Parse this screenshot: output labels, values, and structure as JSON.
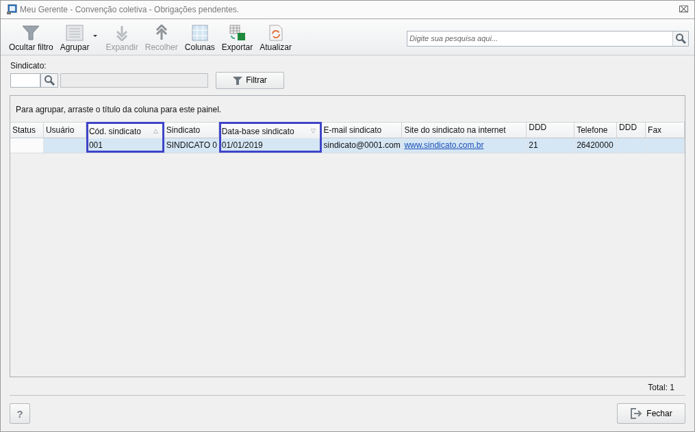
{
  "window": {
    "title": "Meu Gerente - Convenção coletiva - Obrigações pendentes.",
    "close": "⌧"
  },
  "toolbar": [
    {
      "label": "Ocultar filtro",
      "kind": "funnel",
      "disabled": false
    },
    {
      "label": "Agrupar",
      "kind": "list",
      "disabled": false,
      "dropdown": true
    },
    {
      "label": "Expandir",
      "kind": "down",
      "disabled": true
    },
    {
      "label": "Recolher",
      "kind": "up",
      "disabled": true
    },
    {
      "label": "Colunas",
      "kind": "grid",
      "disabled": false
    },
    {
      "label": "Exportar",
      "kind": "excel",
      "disabled": false
    },
    {
      "label": "Atualizar",
      "kind": "refresh",
      "disabled": false
    }
  ],
  "search": {
    "placeholder": "Digite sua pesquisa aqui..."
  },
  "filter": {
    "label": "Sindicato:",
    "button": "Filtrar"
  },
  "group_panel": "Para agrupar, arraste o título da coluna para este painel.",
  "table": {
    "columns": [
      {
        "title": "Status",
        "highlighted": false
      },
      {
        "title": "Usuário",
        "highlighted": false
      },
      {
        "title": "Cód. sindicato",
        "highlighted": true,
        "sort_mark": "△"
      },
      {
        "title": "Sindicato",
        "highlighted": false
      },
      {
        "title": "Data-base sindicato",
        "highlighted": true,
        "sort_mark": "▽"
      },
      {
        "title": "E-mail sindicato",
        "highlighted": false
      },
      {
        "title": "Site do sindicato na internet",
        "highlighted": false
      },
      {
        "title": "DDD",
        "highlighted": false
      },
      {
        "title": "Telefone",
        "highlighted": false
      },
      {
        "title": "DDD",
        "highlighted": false
      },
      {
        "title": "Fax",
        "highlighted": false
      }
    ],
    "rows": [
      {
        "selected": true,
        "cells": [
          "",
          "",
          "001",
          "SINDICATO 0",
          "01/01/2019",
          "sindicato@0001.com",
          "www.sindicato.com.br",
          "21",
          "26420000",
          "",
          ""
        ]
      }
    ]
  },
  "total": "Total: 1",
  "help_button": "?",
  "close_button": "Fechar"
}
